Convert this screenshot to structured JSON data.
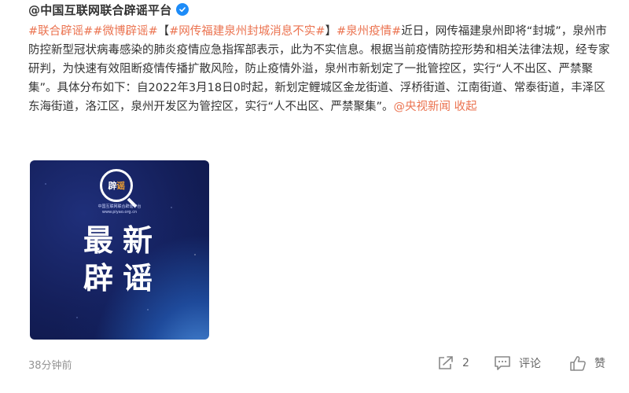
{
  "post": {
    "author": "@中国互联网联合辟谣平台",
    "verified_icon": "verified-badge-icon",
    "content": {
      "tag1": "#联合辟谣#",
      "tag2": "#微博辟谣#",
      "bracket_open": "【",
      "tag3": "#网传福建泉州封城消息不实#",
      "bracket_close": "】",
      "tag4": "#泉州疫情#",
      "body": "近日，网传福建泉州即将“封城”，泉州市防控新型冠状病毒感染的肺炎疫情应急指挥部表示，此为不实信息。根据当前疫情防控形势和相关法律法规，经专家研判，为快速有效阻断疫情传播扩散风险，防止疫情外溢，泉州市新划定了一批管控区，实行“人不出区、严禁聚集”。具体分布如下：自2022年3月18日0时起，新划定鲤城区金龙街道、浮桥街道、江南街道、常泰街道，丰泽区东海街道，洛江区，泉州开发区为管控区，实行“人不出区、严禁聚集”。",
      "source_link": "@央视新闻",
      "favorite_label": "收起"
    },
    "media": {
      "logo_text_a": "辟",
      "logo_text_b": "谣",
      "subtitle": "中国互联网联合辟谣平台",
      "subtitle_url": "www.piyao.org.cn",
      "title_line1": "最新",
      "title_line2": "辟谣"
    },
    "footer": {
      "time": "38分钟前",
      "share_count": "2",
      "comment_label": "评论",
      "like_label": "赞"
    }
  },
  "colors": {
    "accent": "#eb7350",
    "verified": "#1d8cf8",
    "meta_gray": "#939393"
  }
}
